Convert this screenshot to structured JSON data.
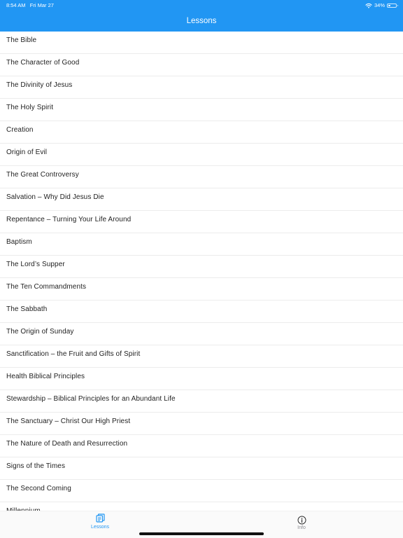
{
  "status_bar": {
    "time": "8:54 AM",
    "date": "Fri Mar 27",
    "battery_text": "34%",
    "battery_level": 0.34
  },
  "header": {
    "title": "Lessons"
  },
  "lessons": [
    {
      "label": "The Bible"
    },
    {
      "label": "The Character of Good"
    },
    {
      "label": "The Divinity of Jesus"
    },
    {
      "label": "The Holy Spirit"
    },
    {
      "label": "Creation"
    },
    {
      "label": "Origin of Evil"
    },
    {
      "label": "The Great Controversy"
    },
    {
      "label": "Salvation – Why Did Jesus Die"
    },
    {
      "label": "Repentance – Turning Your Life Around"
    },
    {
      "label": "Baptism"
    },
    {
      "label": "The Lord’s Supper"
    },
    {
      "label": "The Ten Commandments"
    },
    {
      "label": "The Sabbath"
    },
    {
      "label": "The Origin of Sunday"
    },
    {
      "label": "Sanctification – the Fruit and Gifts of Spirit"
    },
    {
      "label": "Health Biblical Principles"
    },
    {
      "label": "Stewardship – Biblical Principles for an Abundant Life"
    },
    {
      "label": "The Sanctuary – Christ Our High Priest"
    },
    {
      "label": "The Nature of Death and Resurrection"
    },
    {
      "label": "Signs of the Times"
    },
    {
      "label": "The Second Coming"
    },
    {
      "label": "Millennium"
    }
  ],
  "tabbar": {
    "lessons_label": "Lessons",
    "lessons_icon": "book-list-icon",
    "info_label": "Info",
    "info_icon": "info-circle-icon",
    "active_color": "#2196f3",
    "inactive_color": "#8e8e93"
  },
  "colors": {
    "header_bg": "#2196f3"
  }
}
